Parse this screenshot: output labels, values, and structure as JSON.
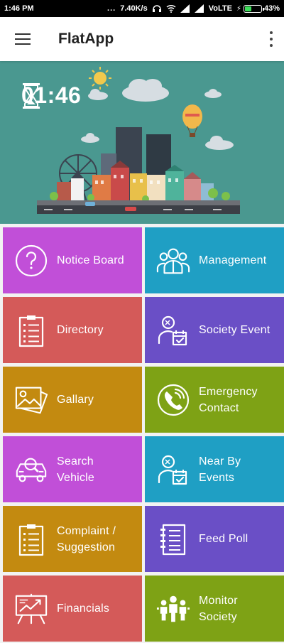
{
  "status_bar": {
    "time": "1:46 PM",
    "dots": "...",
    "speed": "7.40K/s",
    "network": "VoLTE",
    "battery_level": "43%",
    "battery_fraction": 0.43
  },
  "app_bar": {
    "title": "FlatApp",
    "menu_icon": "hamburger-icon",
    "overflow_icon": "more-vert-icon"
  },
  "banner": {
    "clock": "01:46",
    "icon": "hourglass-icon"
  },
  "tiles": [
    {
      "label": "Notice Board",
      "icon": "question-icon",
      "color": "#c14fd8"
    },
    {
      "label": "Management",
      "icon": "management-icon",
      "color": "#1f9fc4"
    },
    {
      "label": "Directory",
      "icon": "directory-list-icon",
      "color": "#d45a59"
    },
    {
      "label": "Society Event",
      "icon": "event-person-icon",
      "color": "#6a4fc6"
    },
    {
      "label": "Gallary",
      "icon": "gallery-icon",
      "color": "#c38a10"
    },
    {
      "label": "Emergency\nContact",
      "icon": "phone-icon",
      "color": "#7ea215"
    },
    {
      "label": "Search\nVehicle",
      "icon": "search-vehicle-icon",
      "color": "#c14fd8"
    },
    {
      "label": "Near By\nEvents",
      "icon": "event-person-icon",
      "color": "#1f9fc4"
    },
    {
      "label": "Complaint /\nSuggestion",
      "icon": "complaint-list-icon",
      "color": "#c38a10"
    },
    {
      "label": "Feed Poll",
      "icon": "notebook-icon",
      "color": "#6a4fc6"
    },
    {
      "label": "Financials",
      "icon": "chart-board-icon",
      "color": "#d45a59"
    },
    {
      "label": "Monitor\nSociety",
      "icon": "people-group-icon",
      "color": "#7ea215"
    }
  ]
}
